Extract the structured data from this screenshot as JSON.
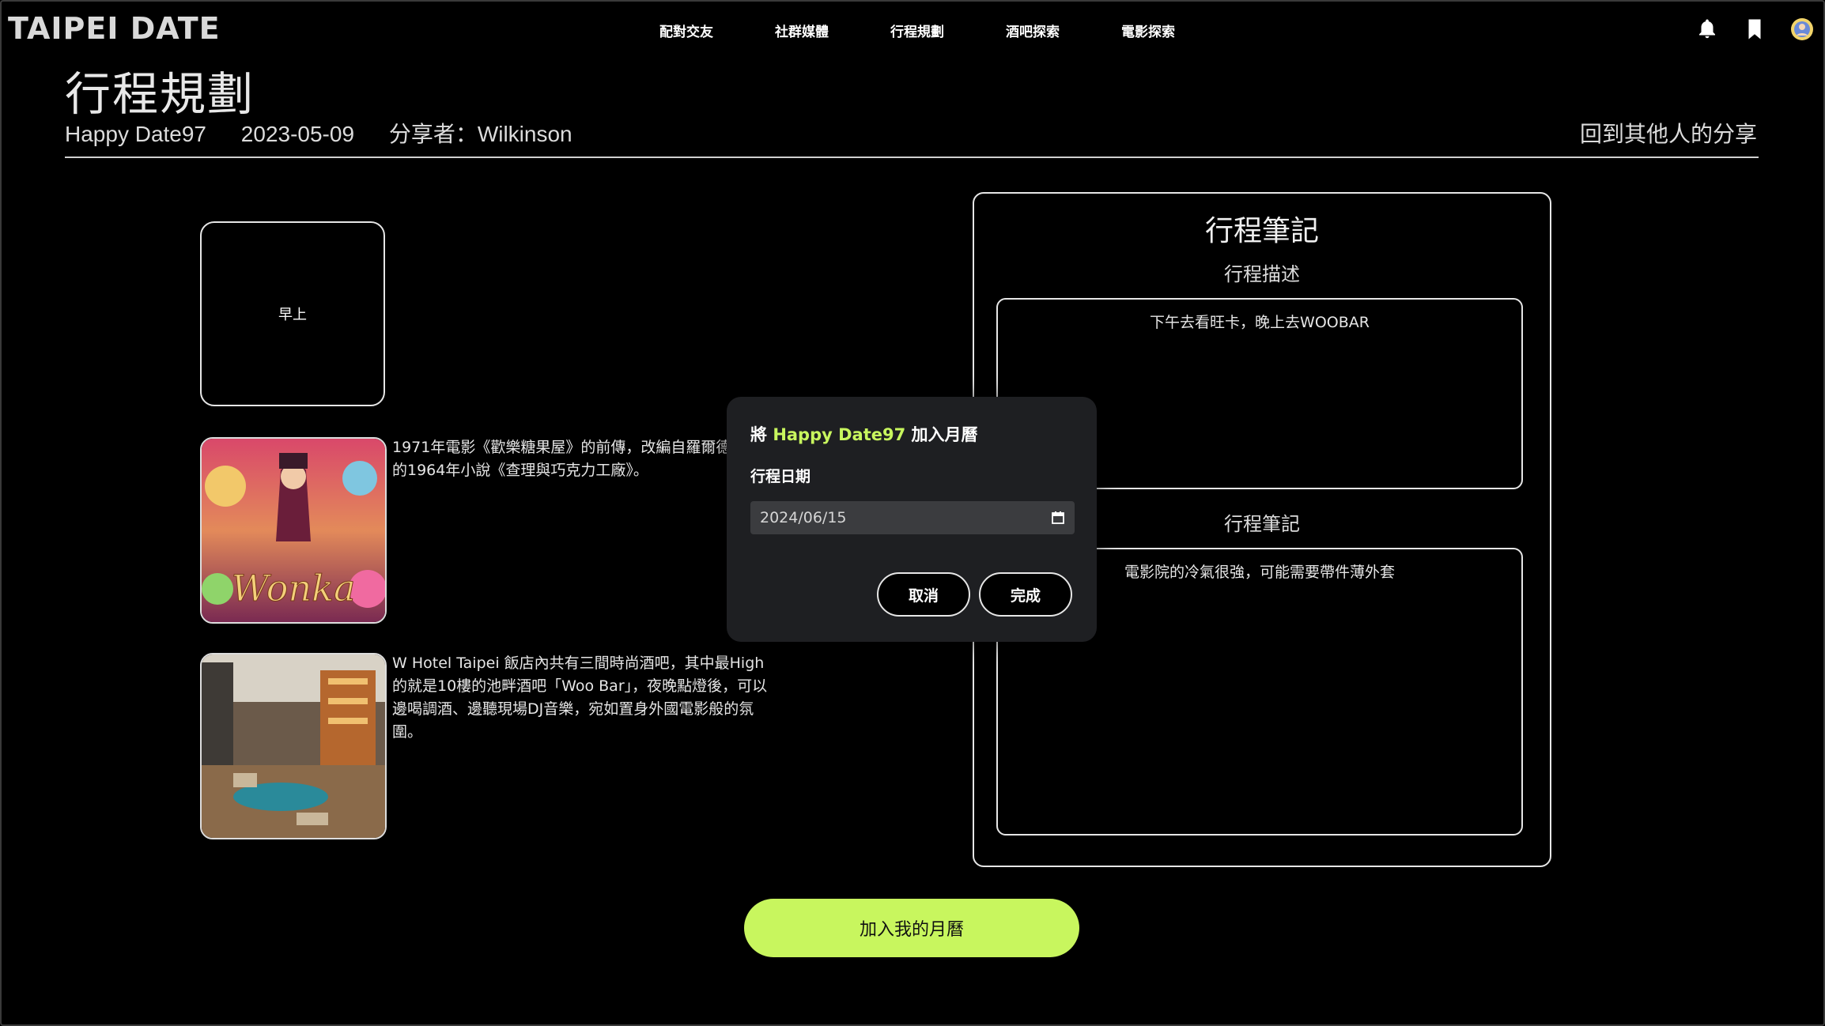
{
  "header": {
    "logo": "TAIPEI DATE",
    "nav": [
      "配對交友",
      "社群媒體",
      "行程規劃",
      "酒吧探索",
      "電影探索"
    ],
    "icons": [
      "bell-icon",
      "bookmark-icon",
      "avatar"
    ]
  },
  "page": {
    "title": "行程規劃",
    "plan_name": "Happy Date97",
    "date": "2023-05-09",
    "sharer": "分享者：Wilkinson",
    "back_link": "回到其他人的分享"
  },
  "schedule": {
    "slot_label": "早上",
    "items": [
      {
        "text": "1971年電影《歡樂糖果屋》的前傳，改編自羅爾德·達爾的1964年小說《查理與巧克力工廠》。",
        "image": "wonka-poster"
      },
      {
        "text": "W Hotel Taipei 飯店內共有三間時尚酒吧，其中最High的就是10樓的池畔酒吧「Woo Bar」，夜晚點燈後，可以邊喝調酒、邊聽現場DJ音樂，宛如置身外國電影般的氛圍。",
        "image": "woo-bar-photo"
      }
    ]
  },
  "notes": {
    "title": "行程筆記",
    "desc_label": "行程描述",
    "desc_text": "下午去看旺卡，晚上去WOOBAR",
    "note_label": "行程筆記",
    "note_text": "電影院的冷氣很強，可能需要帶件薄外套"
  },
  "cta": {
    "label": "加入我的月曆"
  },
  "modal": {
    "title_prefix": "將 ",
    "title_highlight": "Happy Date97",
    "title_suffix": " 加入月曆",
    "date_label": "行程日期",
    "date_value": "2024/06/15",
    "cancel": "取消",
    "done": "完成"
  },
  "colors": {
    "accent": "#c8f65e",
    "background": "#000000",
    "modal_bg": "#1e1f22"
  }
}
